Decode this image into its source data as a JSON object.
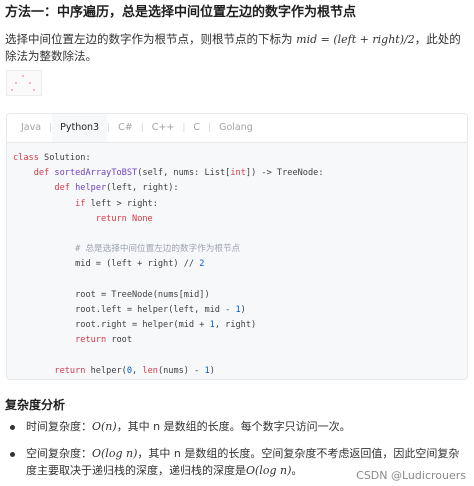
{
  "heading": "方法一：中序遍历，总是选择中间位置左边的数字作为根节点",
  "description": {
    "text1": "选择中间位置左边的数字作为根节点，则根节点的下标为",
    "formula": "mid = (left + right)/2",
    "text2": "，此处的除法为整数除法。"
  },
  "code_tabs": [
    "Java",
    "Python3",
    "C#",
    "C++",
    "C",
    "Golang"
  ],
  "active_tab": "Python3",
  "code": {
    "l1_kw": "class",
    "l1_name": " Solution:",
    "l2_kw": "def",
    "l2_fn": "sortedArrayToBST",
    "l2_rest": "(self, nums: List[",
    "l2_type": "int",
    "l2_end": "]) -> TreeNode:",
    "l3_kw": "def",
    "l3_fn": "helper",
    "l3_rest": "(left, right):",
    "l4_kw": "if",
    "l4_rest": " left > right:",
    "l5_kw": "return",
    "l5_rest": " None",
    "l6_comment": "# 总是选择中间位置左边的数字作为根节点",
    "l7": "mid = (left + right) // ",
    "l7_num": "2",
    "l8": "root = TreeNode(nums[mid])",
    "l9": "root.left = helper(left, mid - ",
    "l9_num": "1",
    "l9_end": ")",
    "l10": "root.right = helper(mid + ",
    "l10_num": "1",
    "l10_end": ", right)",
    "l11_kw": "return",
    "l11_rest": " root",
    "l12_kw": "return",
    "l12_mid": " helper(",
    "l12_num0": "0",
    "l12_sep": ", ",
    "l12_bi": "len",
    "l12_after": "(nums) - ",
    "l12_num1": "1",
    "l12_end": ")"
  },
  "complexity": {
    "title": "复杂度分析",
    "time_prefix": "时间复杂度：",
    "time_formula": "O(n)",
    "time_text": "，其中 n 是数组的长度。每个数字只访问一次。",
    "space_prefix": "空间复杂度：",
    "space_formula": "O(log n)",
    "space_text": "，其中 n 是数组的长度。空间复杂度不考虑返回值，因此空间复杂度主要取决于递归栈的深度，递归栈的深度是",
    "space_formula2": "O(log n)",
    "space_end": "。"
  },
  "watermark": "CSDN @Ludicrouers"
}
